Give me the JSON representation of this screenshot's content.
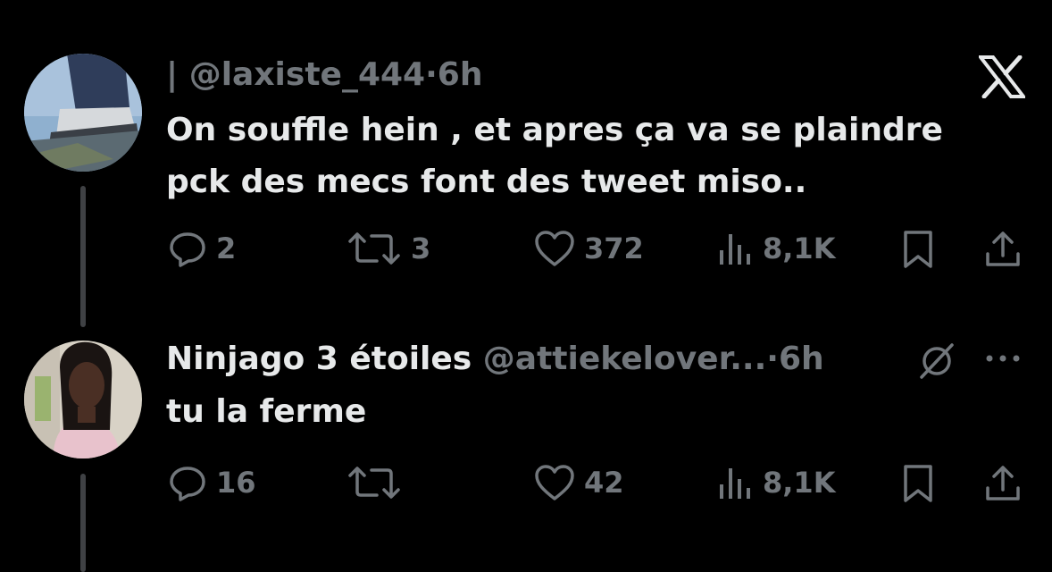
{
  "tweets": [
    {
      "prefix": "|",
      "handle": "@laxiste_444",
      "separator": "·",
      "time": "6h",
      "text_lines": [
        "On souffle hein , et apres ça va se plaindre",
        "pck des mecs font des tweet miso.."
      ],
      "replies": "2",
      "reposts": "3",
      "likes": "372",
      "views": "8,1K"
    },
    {
      "display_name": "Ninjago 3 étoiles",
      "handle": "@attiekelover...",
      "separator": "·",
      "time": "6h",
      "text_lines": [
        "tu la ferme"
      ],
      "replies": "16",
      "reposts": "",
      "likes": "42",
      "views": "8,1K"
    }
  ],
  "icons": {
    "close": "x-logo-icon",
    "not_interested": "circle-slash-icon",
    "more": "more-dots-icon",
    "reply": "reply-bubble-icon",
    "repost": "repost-icon",
    "like": "heart-icon",
    "views": "views-bars-icon",
    "bookmark": "bookmark-icon",
    "share": "share-icon"
  },
  "colors": {
    "background": "#000000",
    "text": "#e7e9ea",
    "muted": "#71767b",
    "thread_line": "#3f4144"
  }
}
